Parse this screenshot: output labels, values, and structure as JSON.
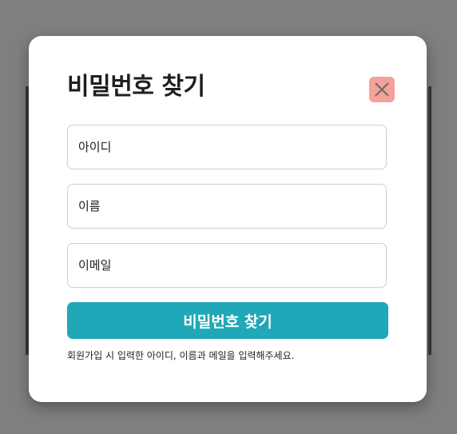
{
  "modal": {
    "title": "비밀번호 찾기",
    "close_icon": "close-icon"
  },
  "form": {
    "id_placeholder": "아이디",
    "name_placeholder": "이름",
    "email_placeholder": "이메일",
    "submit_label": "비밀번호 찾기",
    "helper_text": "회원가입 시 입력한 아이디, 이름과 메일을 입력해주세요."
  },
  "colors": {
    "overlay": "#7f7f7f",
    "close_button_bg": "#f4a09b",
    "close_icon": "#6b6b6b",
    "submit_bg": "#20a7b8",
    "text": "#1f1f1f"
  }
}
